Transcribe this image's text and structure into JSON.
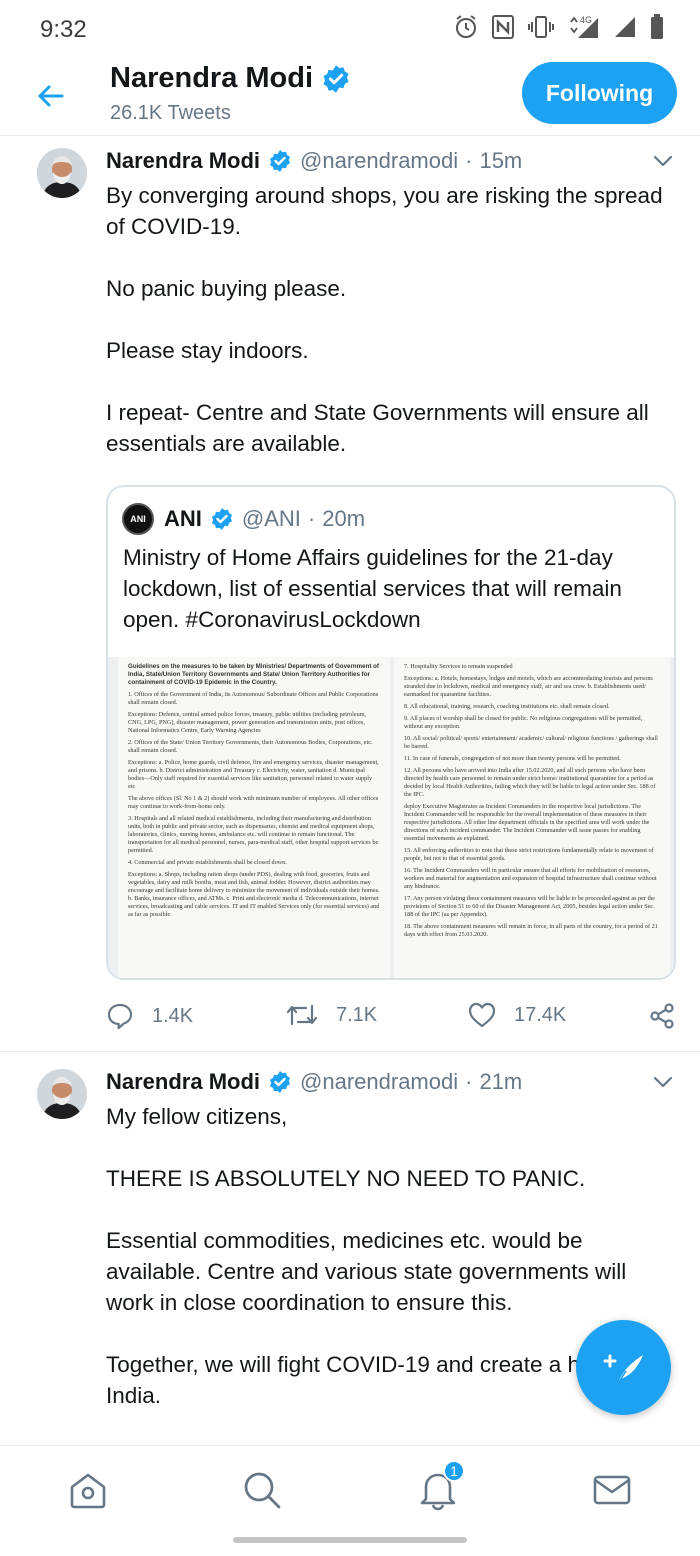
{
  "status_bar": {
    "time": "9:32",
    "icons": [
      "alarm-icon",
      "nfc-icon",
      "vibrate-icon",
      "network-4g-icon",
      "signal-icon",
      "signal-2-icon",
      "battery-icon"
    ],
    "network_label": "4G"
  },
  "header": {
    "title": "Narendra Modi",
    "subtitle": "26.1K Tweets",
    "follow_button": "Following",
    "accent": "#1da1f2"
  },
  "tweets": [
    {
      "author": "Narendra Modi",
      "handle": "@narendramodi",
      "separator": "·",
      "time": "15m",
      "paragraphs": [
        "By converging around shops, you are risking the spread of COVID-19.",
        "No panic buying please.",
        "Please stay indoors.",
        "I repeat- Centre and State Governments will ensure all essentials are available."
      ],
      "quote": {
        "logo": "ANI",
        "author": "ANI",
        "handle": "@ANI",
        "separator": "·",
        "time": "20m",
        "text": "Ministry of Home Affairs guidelines for the 21-day lockdown, list of essential services that will remain open. #CoronavirusLockdown",
        "doc_left_title": "Guidelines on the measures to be taken by Ministries/ Departments of Government of India, State/Union Territory Governments and State/ Union Territory Authorities for containment of COVID-19 Epidemic in the Country.",
        "doc_left_lines": [
          "1. Offices of the Government of India, its Autonomous/ Subordinate Offices and Public Corporations shall remain closed.",
          "Exceptions: Defence, central armed police forces, treasury, public utilities (including petroleum, CNG, LPG, PNG), disaster management, power generation and transmission units, post offices, National Informatics Centre, Early Warning Agencies",
          "2. Offices of the State/ Union Territory Governments, their Autonomous Bodies, Corporations, etc. shall remain closed.",
          "Exceptions: a. Police, home guards, civil defence, fire and emergency services, disaster management, and prisons. b. District administration and Treasury c. Electricity, water, sanitation d. Municipal bodies—Only staff required for essential services like sanitation, personnel related to water supply etc",
          "The above offices (Sl. No 1 & 2) should work with minimum number of employees. All other offices may continue to work-from-home only.",
          "3. Hospitals and all related medical establishments, including their manufacturing and distribution units, both in public and private sector, such as dispensaries, chemist and medical equipment shops, laboratories, clinics, nursing homes, ambulance etc. will continue to remain functional. The transportation for all medical personnel, nurses, para-medical staff, other hospital support services be permitted.",
          "4. Commercial and private establishments shall be closed down.",
          "Exceptions: a. Shops, including ration shops (under PDS), dealing with food, groceries, fruits and vegetables, dairy and milk booths, meat and fish, animal fodder. However, district authorities may encourage and facilitate home delivery to minimize the movement of individuals outside their homes. b. Banks, insurance offices, and ATMs. c. Print and electronic media d. Telecommunications, internet services, broadcasting and cable services. IT and IT enabled Services only (for essential services) and as far as possible"
        ],
        "doc_right_lines": [
          "7. Hospitality Services to remain suspended",
          "Exceptions: a. Hotels, homestays, lodges and motels, which are accommodating tourists and persons stranded due to lockdown, medical and emergency staff, air and sea crew. b. Establishments used/ earmarked for quarantine facilities.",
          "8. All educational, training, research, coaching institutions etc. shall remain closed.",
          "9. All places of worship shall be closed for public. No religious congregations will be permitted, without any exception.",
          "10. All social/ political/ sports/ entertainment/ academic/ cultural/ religious functions / gatherings shall be barred.",
          "11. In case of funerals, congregation of not more than twenty persons will be permitted.",
          "12. All persons who have arrived into India after 15.02.2020, and all such persons who have been directed by health care personnel to remain under strict home/ institutional quarantine for a period as decided by local Health Authorities, failing which they will be liable to legal action under Sec. 188 of the IPC.",
          "deploy Executive Magistrates as Incident Commanders in the respective local jurisdictions. The Incident Commander will be responsible for the overall implementation of these measures in their respective jurisdictions. All other line department officials in the specified area will work under the directions of such incident commander. The Incident Commander will issue passes for enabling essential movements as explained.",
          "15. All enforcing authorities to note that these strict restrictions fundamentally relate to movement of people, but not to that of essential goods.",
          "16. The Incident Commanders will in particular ensure that all efforts for mobilisation of resources, workers and material for augmentation and expansion of hospital infrastructure shall continue without any hindrance.",
          "17. Any person violating these containment measures will be liable to be proceeded against as per the provisions of Section 51 to 60 of the Disaster Management Act, 2005, besides legal action under Sec. 188 of the IPC (as per Appendix).",
          "18. The above containment measures will remain in force, in all parts of the country, for a period of 21 days with effect from 25.03.2020."
        ]
      },
      "replies": "1.4K",
      "retweets": "7.1K",
      "likes": "17.4K"
    },
    {
      "author": "Narendra Modi",
      "handle": "@narendramodi",
      "separator": "·",
      "time": "21m",
      "paragraphs": [
        "My fellow citizens,",
        "THERE IS ABSOLUTELY NO NEED TO PANIC.",
        "Essential commodities, medicines etc. would be available. Centre and various state governments will work in close coordination to ensure this.",
        "Together, we will fight COVID-19 and create a healthier India."
      ]
    }
  ],
  "bottom_nav": {
    "items": [
      "home-icon",
      "search-icon",
      "notifications-icon",
      "messages-icon"
    ],
    "notification_badge": "1"
  }
}
